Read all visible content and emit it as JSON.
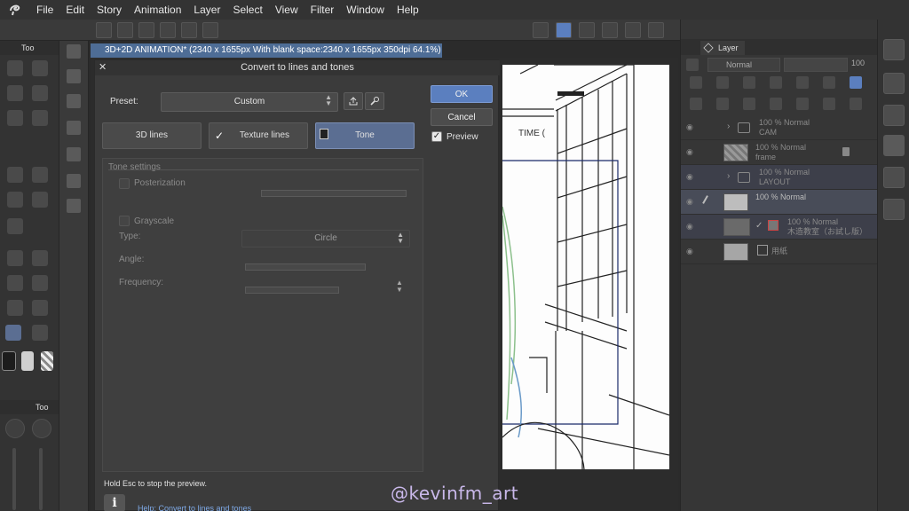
{
  "menu": {
    "items": [
      "File",
      "Edit",
      "Story",
      "Animation",
      "Layer",
      "Select",
      "View",
      "Filter",
      "Window",
      "Help"
    ]
  },
  "left_panel": {
    "tool_title": "Too",
    "sub_title": "Too"
  },
  "document": {
    "tab_title": "3D+2D ANIMATION* (2340 x 1655px With blank space:2340 x 1655px 350dpi 64.1%)"
  },
  "dialog": {
    "title": "Convert to lines and tones",
    "preset_label": "Preset:",
    "preset_value": "Custom",
    "modes": [
      {
        "label": "3D lines",
        "checked": false
      },
      {
        "label": "Texture lines",
        "checked": true
      },
      {
        "label": "Tone",
        "checked": false
      }
    ],
    "ok_label": "OK",
    "cancel_label": "Cancel",
    "preview_label": "Preview",
    "preview_checked": true,
    "tone_settings": {
      "title": "Tone settings",
      "posterization": "Posterization",
      "grayscale": "Grayscale",
      "type_label": "Type:",
      "type_value": "Circle",
      "angle_label": "Angle:",
      "frequency_label": "Frequency:"
    },
    "hint": "Hold Esc to stop the preview.",
    "help_link": "Help: Convert to lines and tones"
  },
  "canvas": {
    "text": "TIME ("
  },
  "layer_panel": {
    "tab_label": "Layer",
    "blend_mode": "Normal",
    "opacity": "100",
    "layers": [
      {
        "line1": "100 % Normal",
        "line2": "CAM",
        "kind": "folder"
      },
      {
        "line1": "100 % Normal",
        "line2": "frame",
        "kind": "raster"
      },
      {
        "line1": "100 % Normal",
        "line2": "LAYOUT",
        "kind": "folder"
      },
      {
        "line1": "100 % Normal",
        "line2": "",
        "kind": "raster",
        "selected": true
      },
      {
        "line1": "100 % Normal",
        "line2": "木造教室（お試し版）",
        "kind": "3d"
      },
      {
        "line1": "",
        "line2": "用紙",
        "kind": "paper"
      }
    ]
  },
  "watermark": "@kevinfm_art",
  "colors": {
    "accent": "#5b7fbf",
    "tab_blue": "#4e6d96",
    "active_mode": "#5b6e92",
    "link": "#7ea9e6",
    "watermark": "#c9b8ea"
  }
}
